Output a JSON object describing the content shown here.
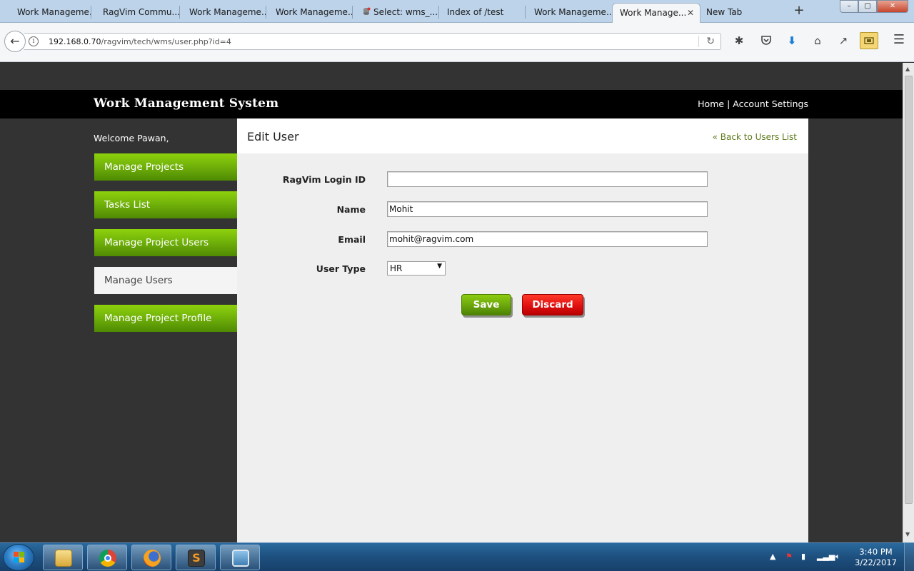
{
  "browser": {
    "tabs": [
      {
        "label": "Work Manageme..."
      },
      {
        "label": "RagVim Commu..."
      },
      {
        "label": "Work Manageme..."
      },
      {
        "label": "Work Manageme..."
      },
      {
        "label": "Select: wms_..."
      },
      {
        "label": "Index of /test"
      },
      {
        "label": "Work Manageme..."
      },
      {
        "label": "Work Manage...",
        "active": true
      },
      {
        "label": "New Tab"
      }
    ],
    "url_host": "192.168.0.70",
    "url_path": "/ragvim/tech/wms/user.php?id=4",
    "new_tab_symbol": "+",
    "window_controls": {
      "minimize": "–",
      "maximize": "▢",
      "close": "✕"
    }
  },
  "site": {
    "title": "Work Management System",
    "nav": {
      "home": "Home",
      "separator": "|",
      "account": "Account Settings"
    },
    "welcome": "Welcome Pawan,"
  },
  "sidebar": {
    "items": [
      {
        "label": "Manage Projects",
        "active": false
      },
      {
        "label": "Tasks List",
        "active": false
      },
      {
        "label": "Manage Project Users",
        "active": false
      },
      {
        "label": "Manage Users",
        "active": true
      },
      {
        "label": "Manage Project Profile",
        "active": false
      }
    ]
  },
  "content": {
    "title": "Edit User",
    "back_link": "« Back to Users List",
    "form": {
      "login_id_label": "RagVim Login ID",
      "login_id_value": "",
      "name_label": "Name",
      "name_value": "Mohit",
      "email_label": "Email",
      "email_value": "mohit@ragvim.com",
      "user_type_label": "User Type",
      "user_type_value": "HR"
    },
    "buttons": {
      "save": "Save",
      "discard": "Discard"
    }
  },
  "taskbar": {
    "time": "3:40 PM",
    "date": "3/22/2017",
    "apps": [
      "file-explorer",
      "chrome",
      "firefox",
      "sublime-text",
      "image-viewer"
    ]
  },
  "colors": {
    "sidebar_green": "#72b30a",
    "save_green": "#6aa50c",
    "discard_red": "#e01010",
    "link_green": "#5d7a1a",
    "page_dark": "#333333"
  }
}
